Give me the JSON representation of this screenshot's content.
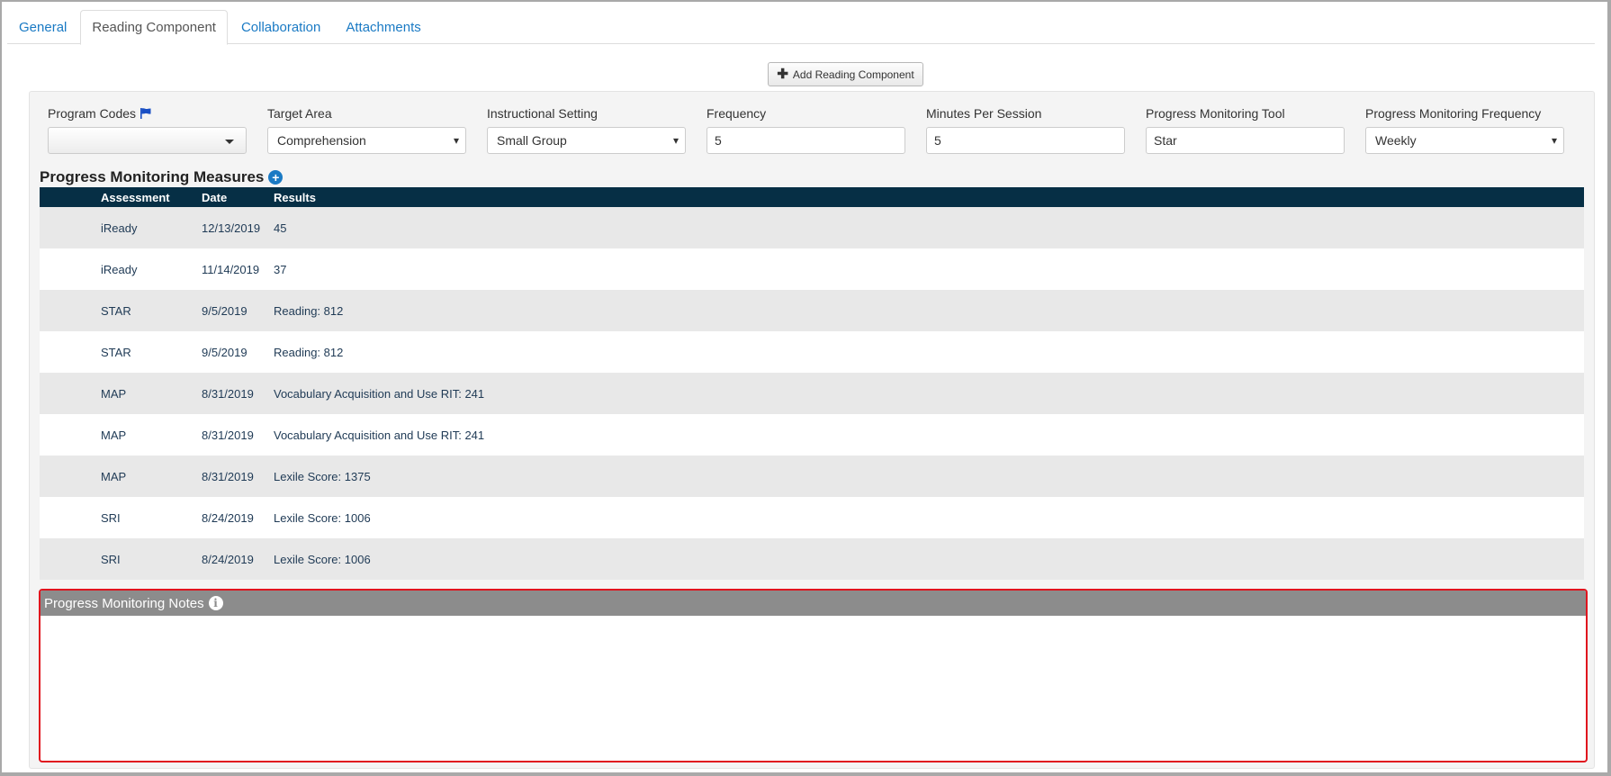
{
  "tabs": [
    {
      "label": "General",
      "active": false
    },
    {
      "label": "Reading Component",
      "active": true
    },
    {
      "label": "Collaboration",
      "active": false
    },
    {
      "label": "Attachments",
      "active": false
    }
  ],
  "add_button": {
    "label": "Add Reading Component",
    "icon": "plus-icon"
  },
  "fields": {
    "program_codes": {
      "label": "Program Codes",
      "value": "",
      "icon": "flag-icon"
    },
    "target_area": {
      "label": "Target Area",
      "value": "Comprehension"
    },
    "instructional_setting": {
      "label": "Instructional Setting",
      "value": "Small Group"
    },
    "frequency": {
      "label": "Frequency",
      "value": "5"
    },
    "minutes_per_session": {
      "label": "Minutes Per Session",
      "value": "5"
    },
    "pm_tool": {
      "label": "Progress Monitoring Tool",
      "value": "Star"
    },
    "pm_frequency": {
      "label": "Progress Monitoring Frequency",
      "value": "Weekly"
    }
  },
  "measures": {
    "title": "Progress Monitoring Measures",
    "columns": [
      "Assessment",
      "Date",
      "Results"
    ],
    "rows": [
      {
        "assessment": "iReady",
        "date": "12/13/2019",
        "results": "45"
      },
      {
        "assessment": "iReady",
        "date": "11/14/2019",
        "results": "37"
      },
      {
        "assessment": "STAR",
        "date": "9/5/2019",
        "results": "Reading: 812"
      },
      {
        "assessment": "STAR",
        "date": "9/5/2019",
        "results": "Reading: 812"
      },
      {
        "assessment": "MAP",
        "date": "8/31/2019",
        "results": "Vocabulary Acquisition and Use RIT: 241"
      },
      {
        "assessment": "MAP",
        "date": "8/31/2019",
        "results": "Vocabulary Acquisition and Use RIT: 241"
      },
      {
        "assessment": "MAP",
        "date": "8/31/2019",
        "results": "Lexile Score: 1375"
      },
      {
        "assessment": "SRI",
        "date": "8/24/2019",
        "results": "Lexile Score: 1006"
      },
      {
        "assessment": "SRI",
        "date": "8/24/2019",
        "results": "Lexile Score: 1006"
      }
    ]
  },
  "notes": {
    "title": "Progress Monitoring Notes",
    "icon": "info-icon",
    "value": ""
  },
  "colors": {
    "link": "#1a7ac4",
    "table_header": "#062f45",
    "notes_header": "#8c8c8c",
    "highlight_border": "#e0141e"
  }
}
